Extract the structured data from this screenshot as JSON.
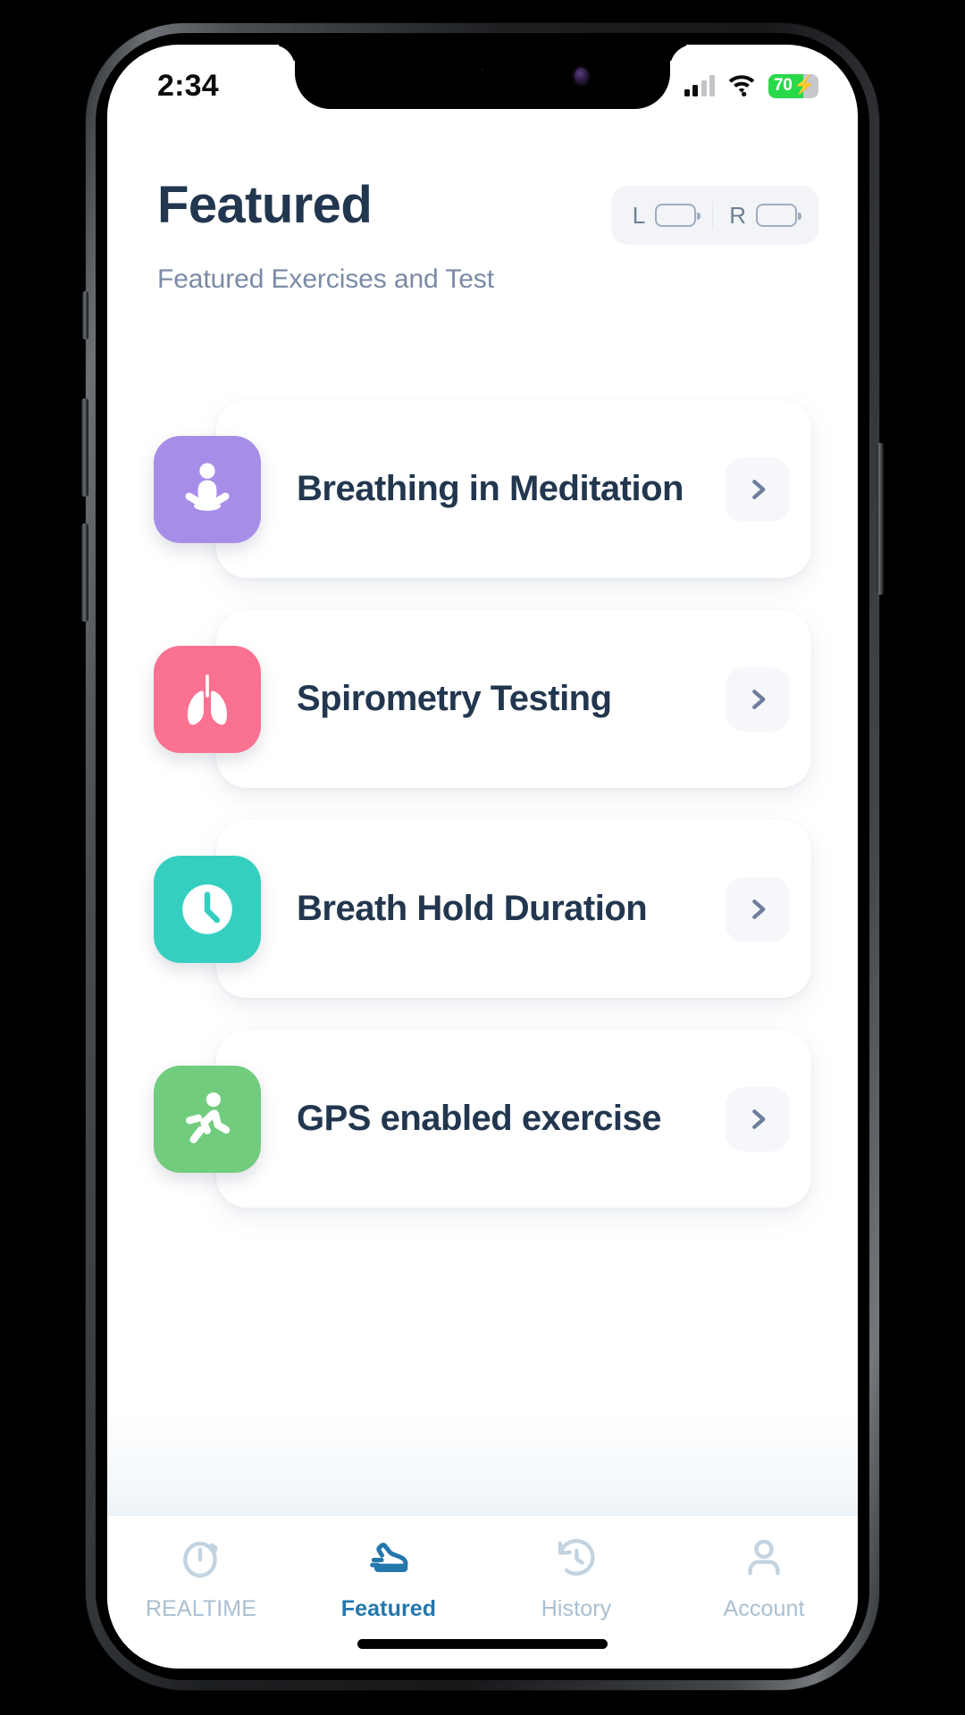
{
  "status_bar": {
    "time": "2:34",
    "battery_level": "70",
    "battery_charging_icon": "bolt-icon",
    "signal_icon": "cellular-signal-icon",
    "wifi_icon": "wifi-icon",
    "signal_bars_filled": 2,
    "signal_bars_total": 4,
    "battery_percent_value": 70
  },
  "header": {
    "title": "Featured",
    "subtitle": "Featured Exercises and Test",
    "device_battery": {
      "left_label": "L",
      "right_label": "R",
      "left_icon": "battery-outline-icon",
      "right_icon": "battery-outline-icon"
    }
  },
  "cards": [
    {
      "title": "Breathing in Meditation",
      "icon": "meditation-icon",
      "color": "#a68ee8",
      "chevron_icon": "chevron-right-icon"
    },
    {
      "title": "Spirometry Testing",
      "icon": "lungs-icon",
      "color": "#fa7191",
      "chevron_icon": "chevron-right-icon"
    },
    {
      "title": "Breath Hold Duration",
      "icon": "clock-icon",
      "color": "#35cfc0",
      "chevron_icon": "chevron-right-icon"
    },
    {
      "title": "GPS enabled exercise",
      "icon": "running-person-icon",
      "color": "#72cc7e",
      "chevron_icon": "chevron-right-icon"
    }
  ],
  "tab_bar": {
    "active_color": "#2477ab",
    "inactive_color": "#a9bfd2",
    "items": [
      {
        "label": "REALTIME",
        "icon": "stopwatch-icon",
        "active": false
      },
      {
        "label": "Featured",
        "icon": "shoe-icon",
        "active": true
      },
      {
        "label": "History",
        "icon": "clock-rewind-icon",
        "active": false
      },
      {
        "label": "Account",
        "icon": "person-icon",
        "active": false
      }
    ]
  }
}
